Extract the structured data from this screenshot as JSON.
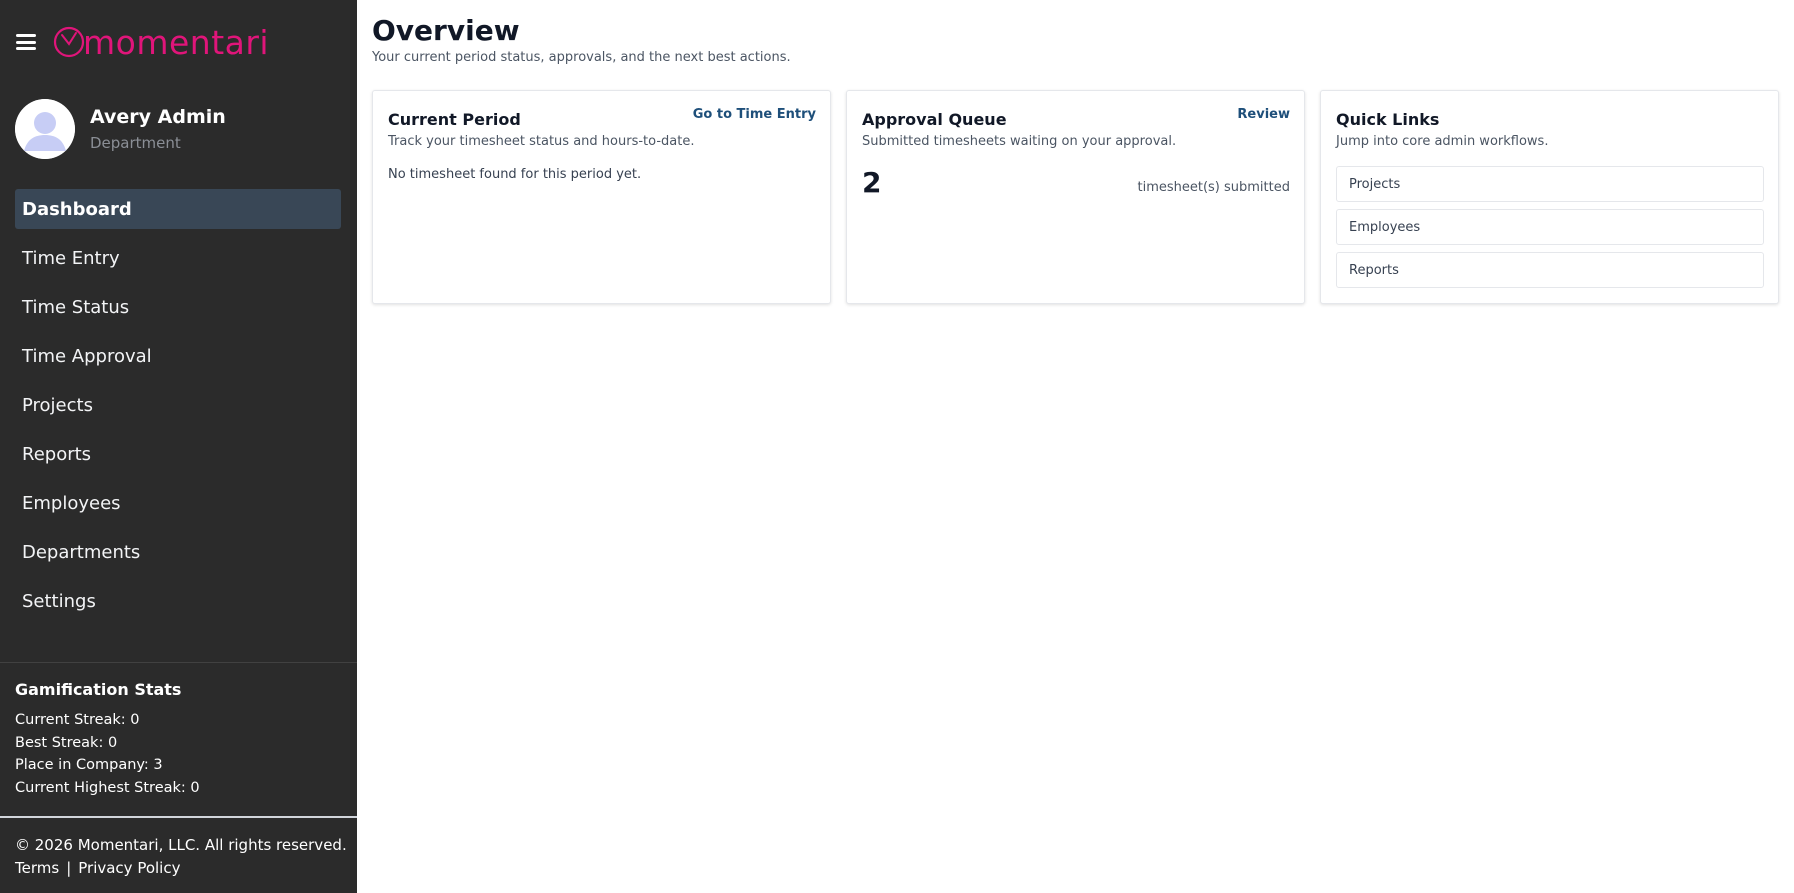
{
  "brand": {
    "name": "momentari",
    "color": "#e0157a",
    "menu_icon": "hamburger-icon",
    "logo_icon": "clock-icon"
  },
  "user": {
    "name": "Avery Admin",
    "department": "Department",
    "avatar_icon": "user-avatar-icon"
  },
  "nav": {
    "items": [
      {
        "label": "Dashboard",
        "active": true
      },
      {
        "label": "Time Entry"
      },
      {
        "label": "Time Status"
      },
      {
        "label": "Time Approval"
      },
      {
        "label": "Projects"
      },
      {
        "label": "Reports"
      },
      {
        "label": "Employees"
      },
      {
        "label": "Departments"
      },
      {
        "label": "Settings"
      }
    ]
  },
  "gamification": {
    "title": "Gamification Stats",
    "lines": [
      "Current Streak: 0",
      "Best Streak: 0",
      "Place in Company: 3",
      "Current Highest Streak: 0"
    ]
  },
  "footer": {
    "copyright": "© 2026 Momentari, LLC. All rights reserved.",
    "terms": "Terms",
    "separator": "|",
    "privacy": "Privacy Policy"
  },
  "page": {
    "title": "Overview",
    "subtitle": "Your current period status, approvals, and the next best actions."
  },
  "cards": {
    "current_period": {
      "title": "Current Period",
      "description": "Track your timesheet status and hours-to-date.",
      "link": "Go to Time Entry",
      "empty_text": "No timesheet found for this period yet."
    },
    "approval_queue": {
      "title": "Approval Queue",
      "description": "Submitted timesheets waiting on your approval.",
      "link": "Review",
      "count": "2",
      "count_label": "timesheet(s) submitted"
    },
    "quick_links": {
      "title": "Quick Links",
      "description": "Jump into core admin workflows.",
      "items": [
        "Projects",
        "Employees",
        "Reports"
      ]
    }
  },
  "colors": {
    "sidebar_bg": "#2b2b2b",
    "active_nav_bg": "#394756",
    "link_color": "#1e4f7a"
  }
}
